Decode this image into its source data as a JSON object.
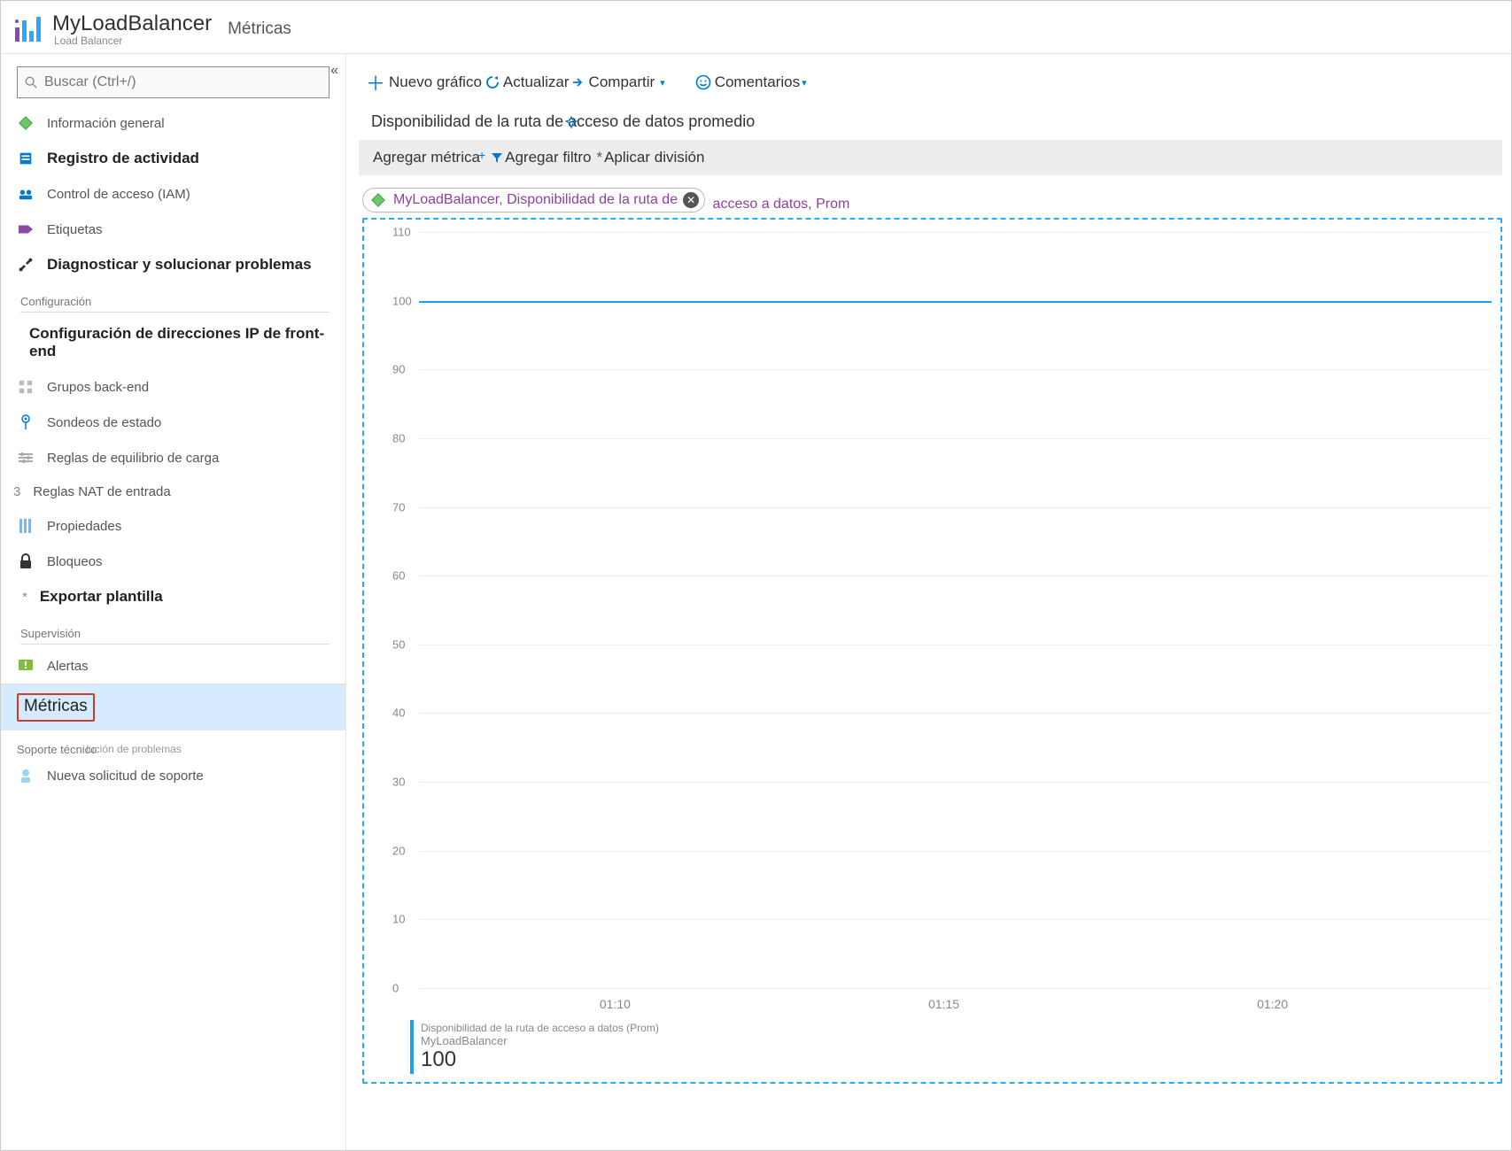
{
  "header": {
    "title": "MyLoadBalancer",
    "subtitle": "Load Balancer",
    "section": "Métricas"
  },
  "sidebar": {
    "search_placeholder": "Buscar (Ctrl+/)",
    "items": [
      {
        "label": "Información general"
      },
      {
        "label": "Registro de actividad"
      },
      {
        "label": "Control de acceso (IAM)"
      },
      {
        "label": "Etiquetas"
      },
      {
        "label": "Diagnosticar y solucionar problemas"
      }
    ],
    "group_config": "Configuración",
    "config_items": [
      {
        "label": "Configuración de direcciones IP de front-end"
      },
      {
        "label": "Grupos back-end"
      },
      {
        "label": "Sondeos de estado"
      },
      {
        "label": "Reglas de equilibrio de carga"
      },
      {
        "prefix": "3",
        "label": "Reglas NAT de entrada"
      },
      {
        "label": "Propiedades"
      },
      {
        "label": "Bloqueos"
      },
      {
        "ast": "*",
        "label": "Exportar plantilla"
      }
    ],
    "group_monitor": "Supervisión",
    "monitor_items": [
      {
        "label": "Alertas"
      },
      {
        "label": "Métricas"
      }
    ],
    "group_support_a": "Soporte técnico",
    "group_support_b": "lución de problemas",
    "support_items": [
      {
        "label": "Nueva solicitud de soporte"
      }
    ]
  },
  "toolbar": {
    "new_chart": "Nuevo gráfico",
    "refresh": "Actualizar",
    "share": "Compartir",
    "feedback": "Comentarios"
  },
  "chart": {
    "title": "Disponibilidad de la ruta de acceso de datos promedio",
    "add_metric": "Agregar métrica",
    "add_filter": "Agregar filtro",
    "apply_split": "Aplicar división"
  },
  "pill": {
    "text_short": "MyLoadBalancer, Disponibilidad de la ruta de",
    "trail": "acceso a datos, Prom"
  },
  "chart_data": {
    "type": "line",
    "y_ticks": [
      "110",
      "100",
      "90",
      "80",
      "70",
      "60",
      "50",
      "40",
      "30",
      "20",
      "10",
      "0"
    ],
    "ylim": [
      0,
      110
    ],
    "x_ticks": [
      "01:10",
      "01:15",
      "01:20"
    ],
    "series": [
      {
        "name": "Disponibilidad de la ruta de acceso a datos (Prom)",
        "resource": "MyLoadBalancer",
        "value_label": "100",
        "constant_value": 100
      }
    ]
  }
}
